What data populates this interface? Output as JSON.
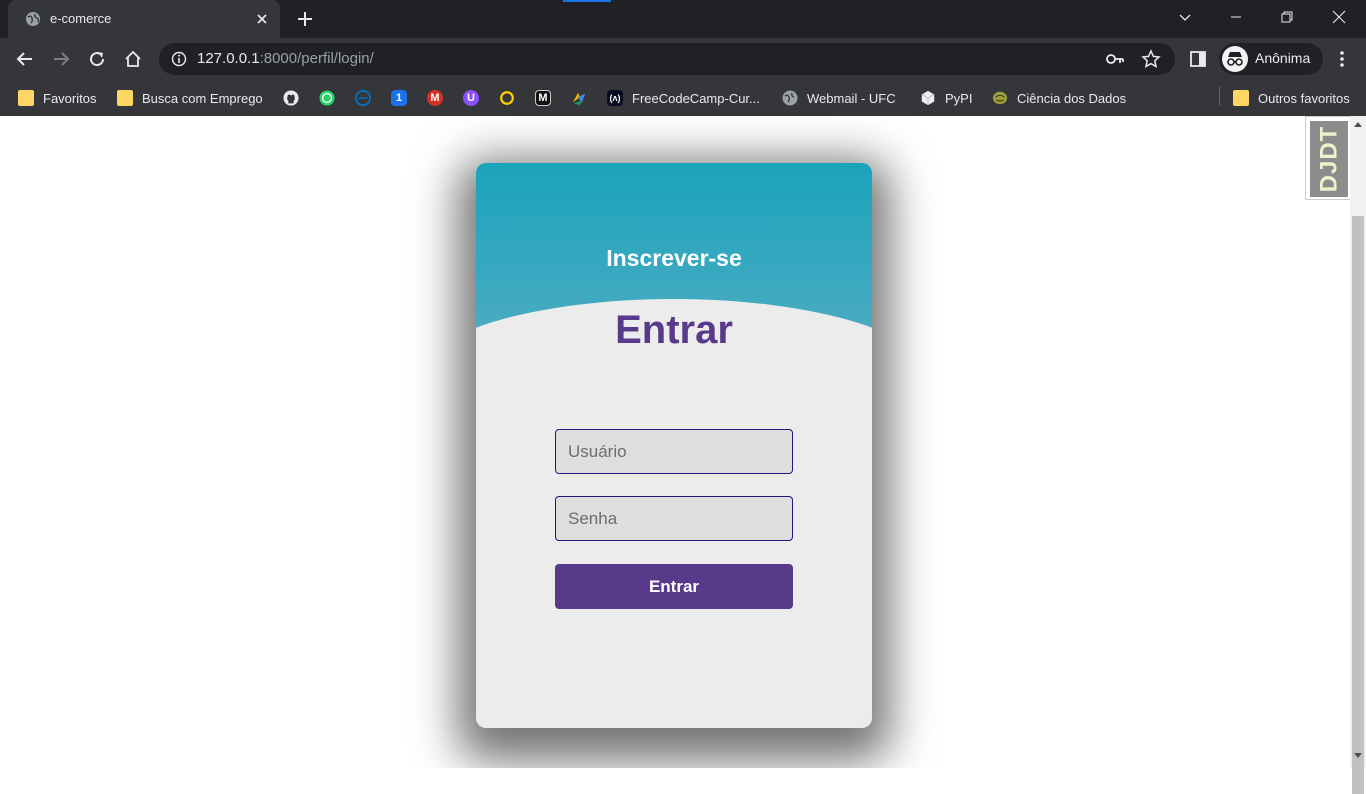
{
  "browser": {
    "tab_title": "e-comerce",
    "url_host": "127.0.0.1",
    "url_rest": ":8000/perfil/login/",
    "profile_label": "Anônima"
  },
  "bookmarks": [
    {
      "label": "Favoritos",
      "icon": "folder-icon"
    },
    {
      "label": "Busca com Emprego",
      "icon": "folder-icon"
    },
    {
      "label": "",
      "icon": "github-icon"
    },
    {
      "label": "",
      "icon": "whatsapp-icon"
    },
    {
      "label": "",
      "icon": "dell-icon"
    },
    {
      "label": "",
      "icon": "calendar-icon"
    },
    {
      "label": "",
      "icon": "gmail-icon"
    },
    {
      "label": "",
      "icon": "proton-icon"
    },
    {
      "label": "",
      "icon": "ring-icon"
    },
    {
      "label": "",
      "icon": "medium-icon"
    },
    {
      "label": "",
      "icon": "colorful-icon"
    },
    {
      "label": "FreeCodeCamp-Cur...",
      "icon": "freecodecamp-icon"
    },
    {
      "label": "Webmail - UFC",
      "icon": "globe-icon"
    },
    {
      "label": "PyPI",
      "icon": "pypi-icon"
    },
    {
      "label": "Ciência dos Dados",
      "icon": "brain-icon"
    }
  ],
  "bookmarks_other": "Outros favoritos",
  "djdt_label": "DJDT",
  "login": {
    "signup_label": "Inscrever-se",
    "title": "Entrar",
    "username_placeholder": "Usuário",
    "password_placeholder": "Senha",
    "submit_label": "Entrar"
  },
  "colors": {
    "card_top": "#1aa3bb",
    "accent": "#593a8a",
    "input_border": "#1d1a7c"
  }
}
